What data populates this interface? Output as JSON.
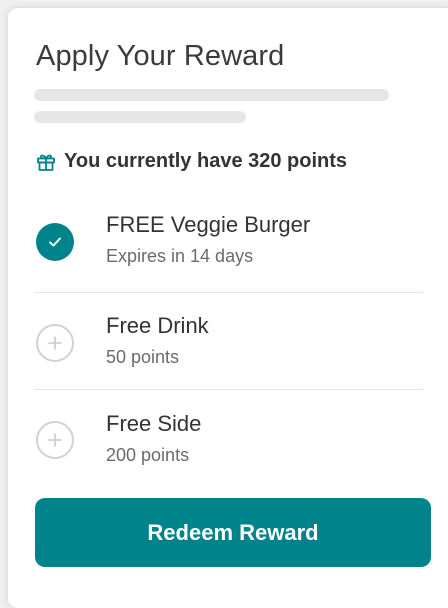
{
  "header": {
    "title": "Apply Your Reward"
  },
  "points": {
    "icon": "gift-icon",
    "text": "You currently have 320 points"
  },
  "rewards": [
    {
      "name": "FREE Veggie Burger",
      "subtitle": "Expires in 14 days",
      "selected": true,
      "icon": "check-icon"
    },
    {
      "name": "Free Drink",
      "subtitle": "50 points",
      "selected": false,
      "icon": "plus-icon"
    },
    {
      "name": "Free Side",
      "subtitle": "200 points",
      "selected": false,
      "icon": "plus-icon"
    }
  ],
  "actions": {
    "redeem_label": "Redeem Reward"
  },
  "colors": {
    "accent": "#00838a",
    "text": "#333333",
    "muted": "#6b6b6b",
    "skeleton": "#e6e6e6"
  }
}
